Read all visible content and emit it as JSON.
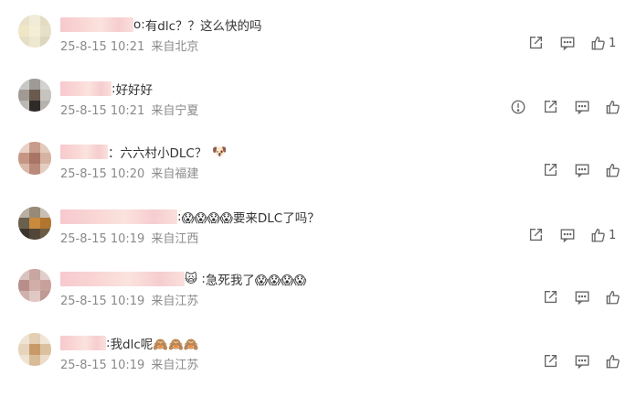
{
  "comments": [
    {
      "tail": "o:",
      "text": "有dlc？？这么快的吗",
      "emoji": "",
      "date": "25-8-15 10:21",
      "location": "来自北京",
      "like_count": "1"
    },
    {
      "tail": ":",
      "text": "好好好",
      "emoji": "",
      "date": "25-8-15 10:21",
      "location": "来自宁夏",
      "like_count": ""
    },
    {
      "tail": "：",
      "text": "六六村小DLC？",
      "emoji": "🐶",
      "date": "25-8-15 10:20",
      "location": "来自福建",
      "like_count": ""
    },
    {
      "tail": ":",
      "text": "😱😱😱😱要来DLC了吗？",
      "emoji": "",
      "date": "25-8-15 10:19",
      "location": "来自江西",
      "like_count": "1"
    },
    {
      "tail": "🙀 :",
      "text": "急死我了😱😱😱😱",
      "emoji": "",
      "date": "25-8-15 10:19",
      "location": "来自江苏",
      "like_count": ""
    },
    {
      "tail": ":",
      "text": "我dlc呢🙈🙈🙈",
      "emoji": "",
      "date": "25-8-15 10:19",
      "location": "来自江苏",
      "like_count": ""
    }
  ],
  "icons": {
    "report": "report-icon",
    "share": "share-icon",
    "comment": "comment-icon",
    "like": "thumbs-up-icon"
  },
  "colors": {
    "text": "#333333",
    "meta": "#8a8a8a",
    "icon": "#666666"
  }
}
